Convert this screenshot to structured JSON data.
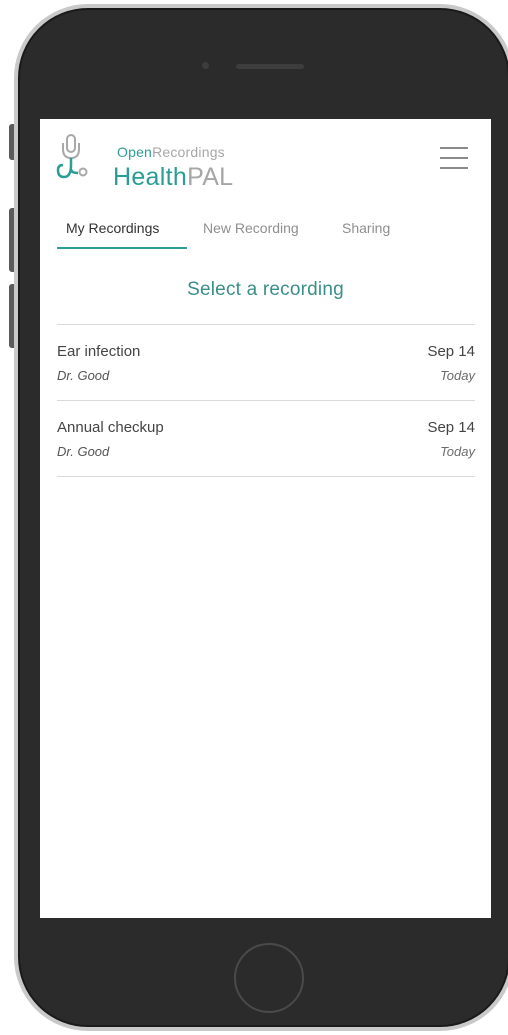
{
  "header": {
    "brand_prefix": "Open",
    "brand_suffix": "Recordings",
    "app_name_primary": "Health",
    "app_name_secondary": "PAL"
  },
  "tabs": [
    {
      "label": "My Recordings",
      "active": true
    },
    {
      "label": "New Recording",
      "active": false
    },
    {
      "label": "Sharing",
      "active": false
    }
  ],
  "main": {
    "title": "Select a recording",
    "recordings": [
      {
        "name": "Ear infection",
        "doctor": "Dr. Good",
        "date": "Sep 14",
        "relative": "Today"
      },
      {
        "name": "Annual checkup",
        "doctor": "Dr. Good",
        "date": "Sep 14",
        "relative": "Today"
      }
    ]
  },
  "icons": {
    "logo": "stethoscope-microphone-icon",
    "menu": "hamburger-menu-icon"
  },
  "colors": {
    "brand_teal": "#2a9d94",
    "brand_gray": "#a6a6a6"
  }
}
